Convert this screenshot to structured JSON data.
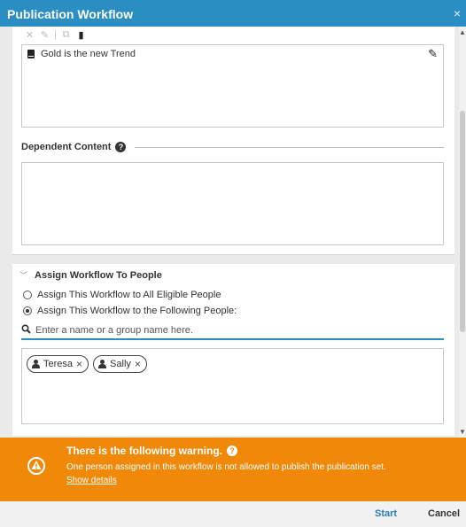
{
  "window": {
    "title": "Publication Workflow",
    "close_glyph": "×"
  },
  "content_items": [
    {
      "icon": "book-icon",
      "label": "Gold is the new Trend"
    }
  ],
  "dependent_content": {
    "label": "Dependent Content"
  },
  "assign": {
    "header": "Assign Workflow To People",
    "options": [
      {
        "label": "Assign This Workflow to All Eligible People",
        "selected": false
      },
      {
        "label": "Assign This Workflow to the Following People:",
        "selected": true
      }
    ],
    "search_placeholder": "Enter a name or a group name here.",
    "people": [
      {
        "name": "Teresa"
      },
      {
        "name": "Sally"
      }
    ]
  },
  "warning": {
    "title": "There is the following warning.",
    "message": "One person assigned in this workflow is not allowed to publish the publication set.",
    "link": "Show details"
  },
  "footer": {
    "start_label": "Start",
    "cancel_label": "Cancel"
  },
  "colors": {
    "title_bar": "#2b8ec3",
    "warning_bg": "#f0880a",
    "accent": "#2b7fb8"
  }
}
